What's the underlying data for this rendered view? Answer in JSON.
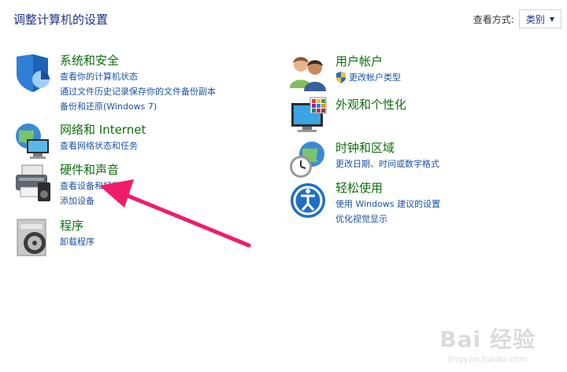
{
  "header": {
    "title": "调整计算机的设置",
    "view_label": "查看方式:",
    "view_value": "类别"
  },
  "left": [
    {
      "title": "系统和安全",
      "icon": "shield-icon",
      "links": [
        "查看你的计算机状态",
        "通过文件历史记录保存你的文件备份副本",
        "备份和还原(Windows 7)"
      ]
    },
    {
      "title": "网络和 Internet",
      "icon": "network-globe-icon",
      "links": [
        "查看网络状态和任务"
      ]
    },
    {
      "title": "硬件和声音",
      "icon": "printer-speaker-icon",
      "links": [
        "查看设备和打印机",
        "添加设备"
      ]
    },
    {
      "title": "程序",
      "icon": "programs-disc-icon",
      "links": [
        "卸载程序"
      ]
    }
  ],
  "right": [
    {
      "title": "用户帐户",
      "icon": "users-icon",
      "links": [
        "更改帐户类型"
      ]
    },
    {
      "title": "外观和个性化",
      "icon": "monitor-palette-icon",
      "links": []
    },
    {
      "title": "时钟和区域",
      "icon": "clock-globe-icon",
      "links": [
        "更改日期、时间或数字格式"
      ]
    },
    {
      "title": "轻松使用",
      "icon": "ease-of-access-icon",
      "links": [
        "使用 Windows 建议的设置",
        "优化视觉显示"
      ]
    }
  ],
  "watermark": {
    "main": "Bai 经验",
    "sub": "jingyan.baidu.com"
  },
  "colors": {
    "title": "#1e3287",
    "category": "#0e6e0e",
    "link": "#1a53a8",
    "arrow": "#f01c6a"
  }
}
